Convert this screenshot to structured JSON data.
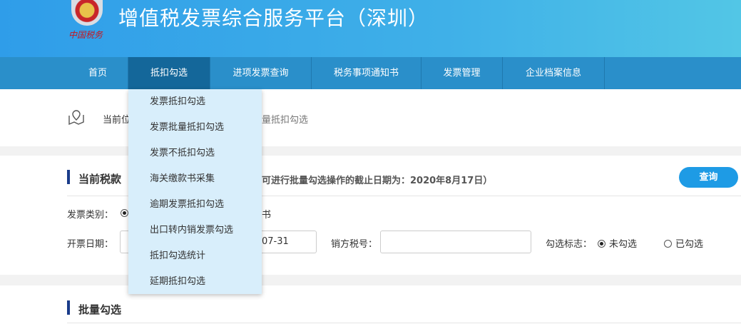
{
  "header": {
    "title": "增值税发票综合服务平台（深圳）",
    "logo_text": "中国税务"
  },
  "nav": [
    {
      "label": "首页"
    },
    {
      "label": "抵扣勾选"
    },
    {
      "label": "进项发票查询"
    },
    {
      "label": "税务事项通知书"
    },
    {
      "label": "发票管理"
    },
    {
      "label": "企业档案信息"
    }
  ],
  "dropdown": [
    "发票抵扣勾选",
    "发票批量抵扣勾选",
    "发票不抵扣勾选",
    "海关缴款书采集",
    "逾期发票抵扣勾选",
    "出口转内销发票勾选",
    "抵扣勾选统计",
    "延期抵扣勾选"
  ],
  "breadcrumb": {
    "left": "当前位",
    "right": "量抵扣勾选"
  },
  "section1": {
    "title": "当前税款",
    "notice": "可进行批量勾选操作的截止日期为：2020年8月17日）",
    "query": "查询"
  },
  "form": {
    "type_label": "发票类别：",
    "type_tail": "书",
    "date_label": "开票日期：",
    "date_end": "07-31",
    "seller_label": "销方税号：",
    "seller_value": "",
    "flag_label": "勾选标志：",
    "flag_unchecked": "未勾选",
    "flag_checked": "已勾选"
  },
  "section2": {
    "title": "批量勾选"
  }
}
